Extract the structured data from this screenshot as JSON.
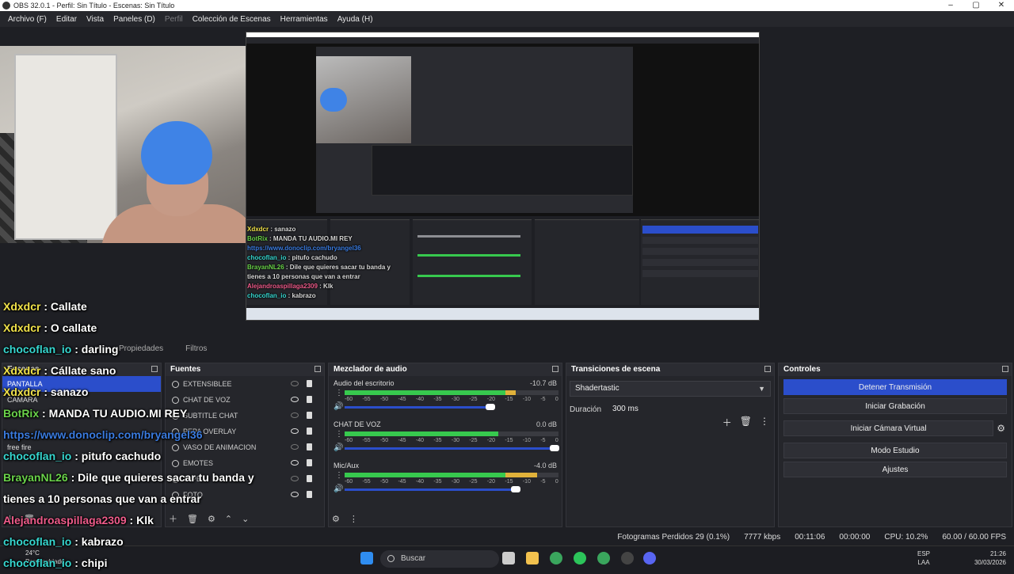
{
  "window": {
    "title": "OBS 32.0.1 - Perfil: Sin Título - Escenas: Sin Título"
  },
  "menu": [
    "Archivo (F)",
    "Editar",
    "Vista",
    "Paneles (D)",
    "Perfil",
    "Colección de Escenas",
    "Herramientas",
    "Ayuda (H)"
  ],
  "chat_nested": [
    {
      "user": "Xdxdcr",
      "msg": " : sanazo",
      "color": "u-yellow"
    },
    {
      "user": "BotRix",
      "msg": " : MANDA TU AUDIO.MI REY",
      "color": "u-green"
    },
    {
      "user": "https://www.donoclip.com/bryangel36",
      "msg": "",
      "color": "u-blue"
    },
    {
      "user": "chocoflan_io",
      "msg": " : pitufo cachudo",
      "color": "u-cyan"
    },
    {
      "user": "BrayanNL26",
      "msg": " : Dile que quieres sacar tu banda y",
      "color": "u-green"
    },
    {
      "user": "",
      "msg": "tienes a 10 personas que van a entrar",
      "color": ""
    },
    {
      "user": "Alejandroaspillaga2309",
      "msg": " : Klk",
      "color": "u-pink"
    },
    {
      "user": "chocoflan_io",
      "msg": " : kabrazo",
      "color": "u-cyan"
    }
  ],
  "chat": [
    {
      "user": "Xdxdcr",
      "msg": " : Callate",
      "color": "u-yellow"
    },
    {
      "user": "Xdxdcr",
      "msg": " : O callate",
      "color": "u-yellow"
    },
    {
      "user": "chocoflan_io",
      "msg": " : darling",
      "color": "u-cyan"
    },
    {
      "user": "Xdxdcr",
      "msg": " : Cállate sano",
      "color": "u-yellow"
    },
    {
      "user": "Xdxdcr",
      "msg": " : sanazo",
      "color": "u-yellow"
    },
    {
      "user": "BotRix",
      "msg": " : MANDA TU AUDIO.MI REY",
      "color": "u-green"
    },
    {
      "user": "https://www.donoclip.com/bryangel36",
      "msg": "",
      "color": "u-blue"
    },
    {
      "user": "chocoflan_io",
      "msg": " : pitufo cachudo",
      "color": "u-cyan"
    },
    {
      "user": "BrayanNL26",
      "msg": " : Dile que quieres sacar tu banda y",
      "color": "u-green"
    },
    {
      "user": "",
      "msg": "tienes a 10 personas que van a entrar",
      "color": ""
    },
    {
      "user": "Alejandroaspillaga2309",
      "msg": " : Klk",
      "color": "u-pink"
    },
    {
      "user": "chocoflan_io",
      "msg": " : kabrazo",
      "color": "u-cyan"
    },
    {
      "user": "chocoflan_io",
      "msg": " : chipi",
      "color": "u-cyan"
    }
  ],
  "tabs": {
    "properties": "Propiedades",
    "filters": "Filtros"
  },
  "scenes": {
    "title": "Escenas",
    "items": [
      "PANTALLA",
      "CAMARA"
    ],
    "selected_index": 0,
    "extra_label": "free fire"
  },
  "sources": {
    "title": "Fuentes",
    "items": [
      {
        "name": "EXTENSIBLEE",
        "visible": false
      },
      {
        "name": "CHAT DE VOZ",
        "visible": true
      },
      {
        "name": "SUBTITLE CHAT",
        "visible": false
      },
      {
        "name": "PEPA OVERLAY",
        "visible": true
      },
      {
        "name": "VASO DE ANIMACION",
        "visible": false
      },
      {
        "name": "EMOTES",
        "visible": true
      },
      {
        "name": "TAPE",
        "visible": false
      },
      {
        "name": "FOTO",
        "visible": true
      }
    ]
  },
  "mixer": {
    "title": "Mezclador de audio",
    "channels": [
      {
        "name": "Audio del escritorio",
        "db": "-10.7 dB",
        "level": 0.8,
        "fader": 0.68
      },
      {
        "name": "CHAT DE VOZ",
        "db": "0.0 dB",
        "level": 0.72,
        "fader": 0.98
      },
      {
        "name": "Mic/Aux",
        "db": "-4.0 dB",
        "level": 0.9,
        "fader": 0.8
      }
    ],
    "ticks": [
      "-60",
      "-55",
      "-50",
      "-45",
      "-40",
      "-35",
      "-30",
      "-25",
      "-20",
      "-15",
      "-10",
      "-5",
      "0"
    ]
  },
  "transitions": {
    "title": "Transiciones de escena",
    "selected": "Shadertastic",
    "duration_label": "Duración",
    "duration_value": "300 ms"
  },
  "controls": {
    "title": "Controles",
    "stop_stream": "Detener Transmisión",
    "start_recording": "Iniciar Grabación",
    "virtual_cam": "Iniciar Cámara Virtual",
    "studio_mode": "Modo Estudio",
    "settings": "Ajustes"
  },
  "status": {
    "dropped_frames": "Fotogramas Perdidos 29 (0.1%)",
    "bitrate": "7777 kbps",
    "stream_time": "00:11:06",
    "rec_time": "00:00:00",
    "cpu": "CPU: 10.2%",
    "fps": "60.00 / 60.00 FPS"
  },
  "taskbar": {
    "search_placeholder": "Buscar",
    "lang_top": "ESP",
    "lang_bottom": "LAA",
    "time": "21:26",
    "date": "30/03/2026",
    "weather": "24°C",
    "weather_desc": "Parc. nublado"
  }
}
